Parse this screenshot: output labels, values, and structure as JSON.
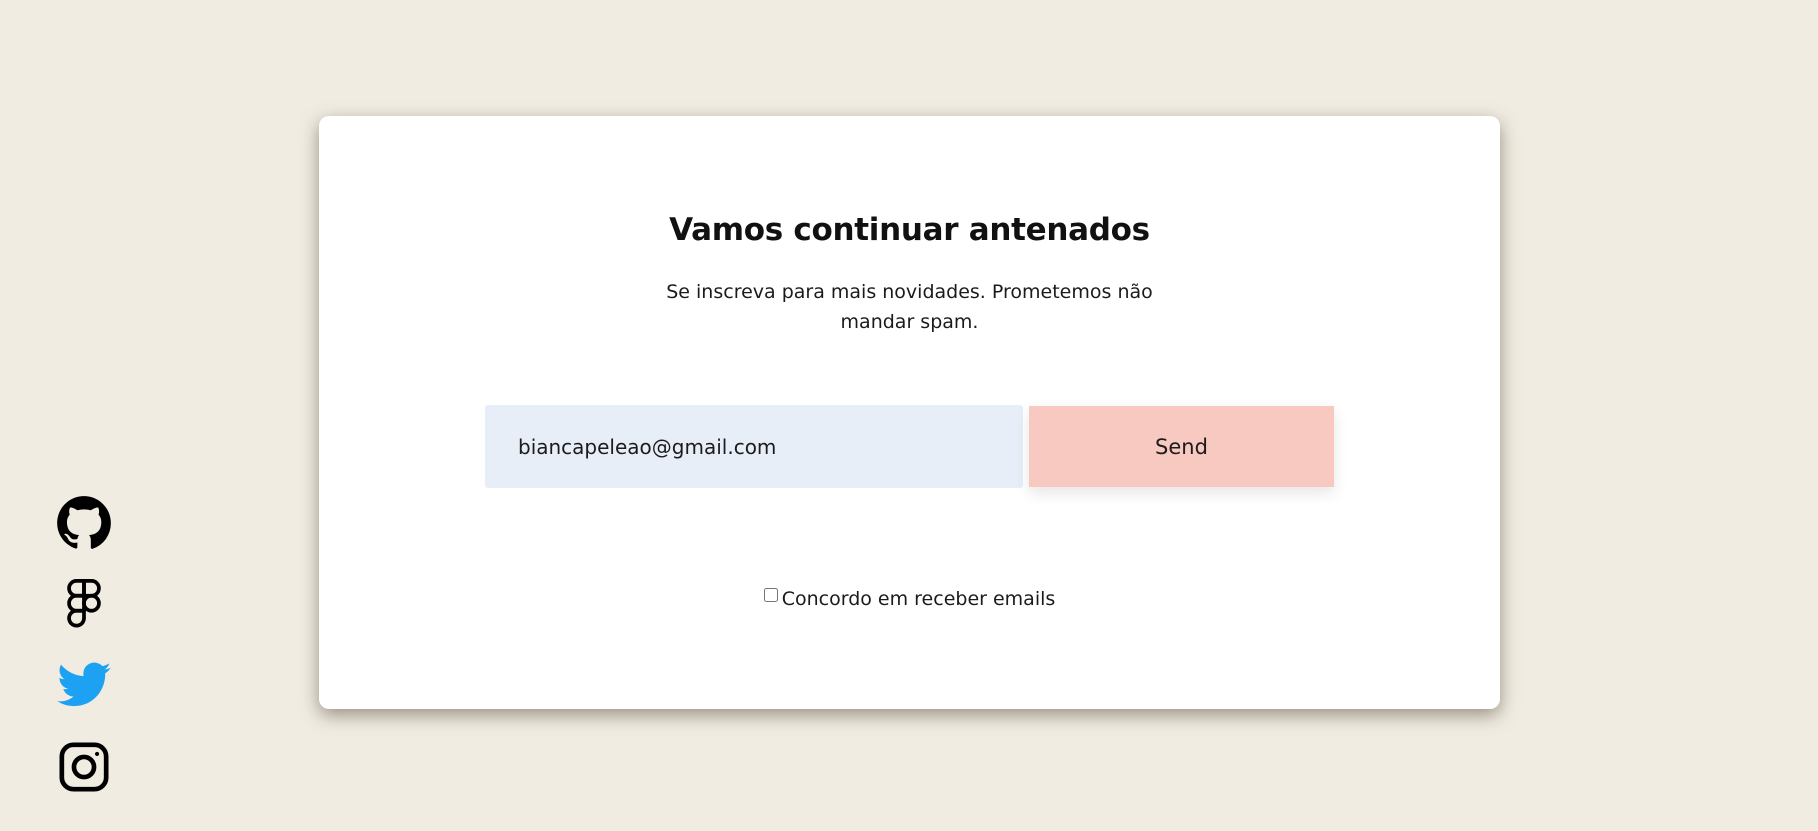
{
  "card": {
    "title": "Vamos continuar antenados",
    "subtitle": "Se inscreva para mais novidades. Prometemos não mandar spam."
  },
  "form": {
    "email_value": "biancapeleao@gmail.com",
    "send_label": "Send",
    "agree_label": "Concordo em receber emails",
    "agree_checked": false
  },
  "social": {
    "items": [
      {
        "name": "github",
        "icon": "github-icon",
        "color": "#000000"
      },
      {
        "name": "figma",
        "icon": "figma-icon",
        "color": "#000000"
      },
      {
        "name": "twitter",
        "icon": "twitter-icon",
        "color": "#1da1f2"
      },
      {
        "name": "instagram",
        "icon": "instagram-icon",
        "color": "#000000"
      }
    ]
  },
  "colors": {
    "background": "#f1ece2",
    "card": "#ffffff",
    "input_bg": "#e8eef8",
    "button_bg": "#f7c9c0"
  }
}
